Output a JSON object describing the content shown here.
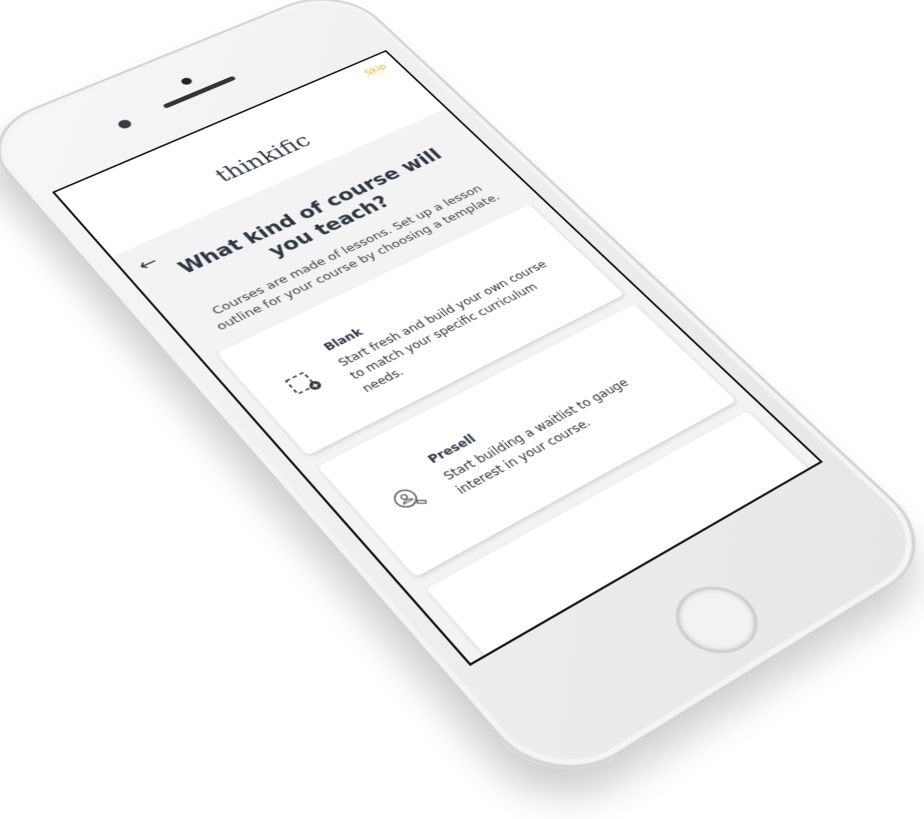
{
  "header": {
    "skip_label": "Skip",
    "logo": "thinkific",
    "back_icon": "arrow-left-icon"
  },
  "main": {
    "title": "What kind of course will you teach?",
    "subtitle": "Courses are made of lessons. Set up a lesson outline for your course by choosing a template.",
    "templates": [
      {
        "name": "Blank",
        "description": "Start fresh and build your own course to match your specific curriculum needs.",
        "icon": "dashed-square-plus-icon"
      },
      {
        "name": "Presell",
        "description": "Start building a waitlist to gauge interest in your course.",
        "icon": "user-search-icon"
      },
      {
        "name": "",
        "description": "",
        "icon": ""
      }
    ]
  },
  "colors": {
    "accent": "#f0b429",
    "text": "#2c3745",
    "background": "#f3f3f3"
  }
}
